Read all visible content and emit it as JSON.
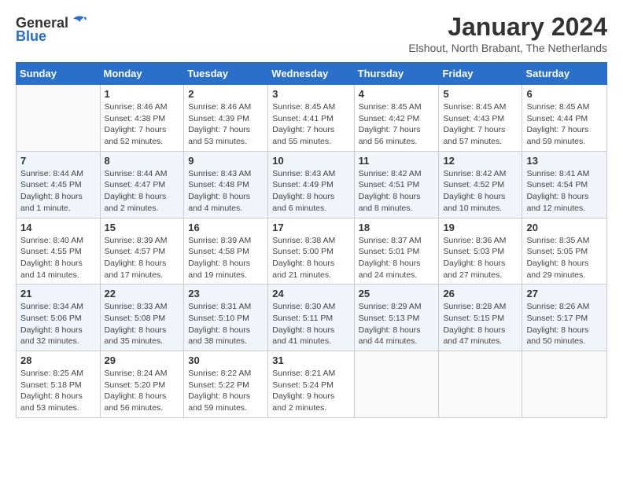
{
  "header": {
    "logo_general": "General",
    "logo_blue": "Blue",
    "title": "January 2024",
    "subtitle": "Elshout, North Brabant, The Netherlands"
  },
  "calendar": {
    "headers": [
      "Sunday",
      "Monday",
      "Tuesday",
      "Wednesday",
      "Thursday",
      "Friday",
      "Saturday"
    ],
    "weeks": [
      [
        {
          "day": "",
          "sunrise": "",
          "sunset": "",
          "daylight": ""
        },
        {
          "day": "1",
          "sunrise": "Sunrise: 8:46 AM",
          "sunset": "Sunset: 4:38 PM",
          "daylight": "Daylight: 7 hours and 52 minutes."
        },
        {
          "day": "2",
          "sunrise": "Sunrise: 8:46 AM",
          "sunset": "Sunset: 4:39 PM",
          "daylight": "Daylight: 7 hours and 53 minutes."
        },
        {
          "day": "3",
          "sunrise": "Sunrise: 8:45 AM",
          "sunset": "Sunset: 4:41 PM",
          "daylight": "Daylight: 7 hours and 55 minutes."
        },
        {
          "day": "4",
          "sunrise": "Sunrise: 8:45 AM",
          "sunset": "Sunset: 4:42 PM",
          "daylight": "Daylight: 7 hours and 56 minutes."
        },
        {
          "day": "5",
          "sunrise": "Sunrise: 8:45 AM",
          "sunset": "Sunset: 4:43 PM",
          "daylight": "Daylight: 7 hours and 57 minutes."
        },
        {
          "day": "6",
          "sunrise": "Sunrise: 8:45 AM",
          "sunset": "Sunset: 4:44 PM",
          "daylight": "Daylight: 7 hours and 59 minutes."
        }
      ],
      [
        {
          "day": "7",
          "sunrise": "Sunrise: 8:44 AM",
          "sunset": "Sunset: 4:45 PM",
          "daylight": "Daylight: 8 hours and 1 minute."
        },
        {
          "day": "8",
          "sunrise": "Sunrise: 8:44 AM",
          "sunset": "Sunset: 4:47 PM",
          "daylight": "Daylight: 8 hours and 2 minutes."
        },
        {
          "day": "9",
          "sunrise": "Sunrise: 8:43 AM",
          "sunset": "Sunset: 4:48 PM",
          "daylight": "Daylight: 8 hours and 4 minutes."
        },
        {
          "day": "10",
          "sunrise": "Sunrise: 8:43 AM",
          "sunset": "Sunset: 4:49 PM",
          "daylight": "Daylight: 8 hours and 6 minutes."
        },
        {
          "day": "11",
          "sunrise": "Sunrise: 8:42 AM",
          "sunset": "Sunset: 4:51 PM",
          "daylight": "Daylight: 8 hours and 8 minutes."
        },
        {
          "day": "12",
          "sunrise": "Sunrise: 8:42 AM",
          "sunset": "Sunset: 4:52 PM",
          "daylight": "Daylight: 8 hours and 10 minutes."
        },
        {
          "day": "13",
          "sunrise": "Sunrise: 8:41 AM",
          "sunset": "Sunset: 4:54 PM",
          "daylight": "Daylight: 8 hours and 12 minutes."
        }
      ],
      [
        {
          "day": "14",
          "sunrise": "Sunrise: 8:40 AM",
          "sunset": "Sunset: 4:55 PM",
          "daylight": "Daylight: 8 hours and 14 minutes."
        },
        {
          "day": "15",
          "sunrise": "Sunrise: 8:39 AM",
          "sunset": "Sunset: 4:57 PM",
          "daylight": "Daylight: 8 hours and 17 minutes."
        },
        {
          "day": "16",
          "sunrise": "Sunrise: 8:39 AM",
          "sunset": "Sunset: 4:58 PM",
          "daylight": "Daylight: 8 hours and 19 minutes."
        },
        {
          "day": "17",
          "sunrise": "Sunrise: 8:38 AM",
          "sunset": "Sunset: 5:00 PM",
          "daylight": "Daylight: 8 hours and 21 minutes."
        },
        {
          "day": "18",
          "sunrise": "Sunrise: 8:37 AM",
          "sunset": "Sunset: 5:01 PM",
          "daylight": "Daylight: 8 hours and 24 minutes."
        },
        {
          "day": "19",
          "sunrise": "Sunrise: 8:36 AM",
          "sunset": "Sunset: 5:03 PM",
          "daylight": "Daylight: 8 hours and 27 minutes."
        },
        {
          "day": "20",
          "sunrise": "Sunrise: 8:35 AM",
          "sunset": "Sunset: 5:05 PM",
          "daylight": "Daylight: 8 hours and 29 minutes."
        }
      ],
      [
        {
          "day": "21",
          "sunrise": "Sunrise: 8:34 AM",
          "sunset": "Sunset: 5:06 PM",
          "daylight": "Daylight: 8 hours and 32 minutes."
        },
        {
          "day": "22",
          "sunrise": "Sunrise: 8:33 AM",
          "sunset": "Sunset: 5:08 PM",
          "daylight": "Daylight: 8 hours and 35 minutes."
        },
        {
          "day": "23",
          "sunrise": "Sunrise: 8:31 AM",
          "sunset": "Sunset: 5:10 PM",
          "daylight": "Daylight: 8 hours and 38 minutes."
        },
        {
          "day": "24",
          "sunrise": "Sunrise: 8:30 AM",
          "sunset": "Sunset: 5:11 PM",
          "daylight": "Daylight: 8 hours and 41 minutes."
        },
        {
          "day": "25",
          "sunrise": "Sunrise: 8:29 AM",
          "sunset": "Sunset: 5:13 PM",
          "daylight": "Daylight: 8 hours and 44 minutes."
        },
        {
          "day": "26",
          "sunrise": "Sunrise: 8:28 AM",
          "sunset": "Sunset: 5:15 PM",
          "daylight": "Daylight: 8 hours and 47 minutes."
        },
        {
          "day": "27",
          "sunrise": "Sunrise: 8:26 AM",
          "sunset": "Sunset: 5:17 PM",
          "daylight": "Daylight: 8 hours and 50 minutes."
        }
      ],
      [
        {
          "day": "28",
          "sunrise": "Sunrise: 8:25 AM",
          "sunset": "Sunset: 5:18 PM",
          "daylight": "Daylight: 8 hours and 53 minutes."
        },
        {
          "day": "29",
          "sunrise": "Sunrise: 8:24 AM",
          "sunset": "Sunset: 5:20 PM",
          "daylight": "Daylight: 8 hours and 56 minutes."
        },
        {
          "day": "30",
          "sunrise": "Sunrise: 8:22 AM",
          "sunset": "Sunset: 5:22 PM",
          "daylight": "Daylight: 8 hours and 59 minutes."
        },
        {
          "day": "31",
          "sunrise": "Sunrise: 8:21 AM",
          "sunset": "Sunset: 5:24 PM",
          "daylight": "Daylight: 9 hours and 2 minutes."
        },
        {
          "day": "",
          "sunrise": "",
          "sunset": "",
          "daylight": ""
        },
        {
          "day": "",
          "sunrise": "",
          "sunset": "",
          "daylight": ""
        },
        {
          "day": "",
          "sunrise": "",
          "sunset": "",
          "daylight": ""
        }
      ]
    ]
  }
}
